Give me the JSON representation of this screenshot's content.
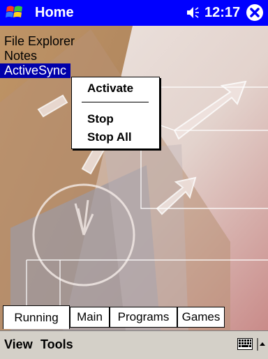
{
  "titlebar": {
    "title": "Home",
    "clock": "12:17",
    "icons": [
      "start-windows-logo-icon",
      "speaker-icon",
      "close-icon"
    ],
    "color": "#0000ff"
  },
  "running_programs": [
    {
      "label": "File Explorer",
      "selected": false
    },
    {
      "label": "Notes",
      "selected": false
    },
    {
      "label": "ActiveSync",
      "selected": true
    }
  ],
  "context_menu": {
    "items": [
      "Activate",
      "Stop",
      "Stop All"
    ]
  },
  "tabs": [
    {
      "label": "Running",
      "active": true
    },
    {
      "label": "Main",
      "active": false
    },
    {
      "label": "Programs",
      "active": false
    },
    {
      "label": "Games",
      "active": false
    }
  ],
  "menubar": {
    "view": "View",
    "tools": "Tools",
    "icons": [
      "keyboard-icon",
      "up-arrow-icon"
    ]
  }
}
